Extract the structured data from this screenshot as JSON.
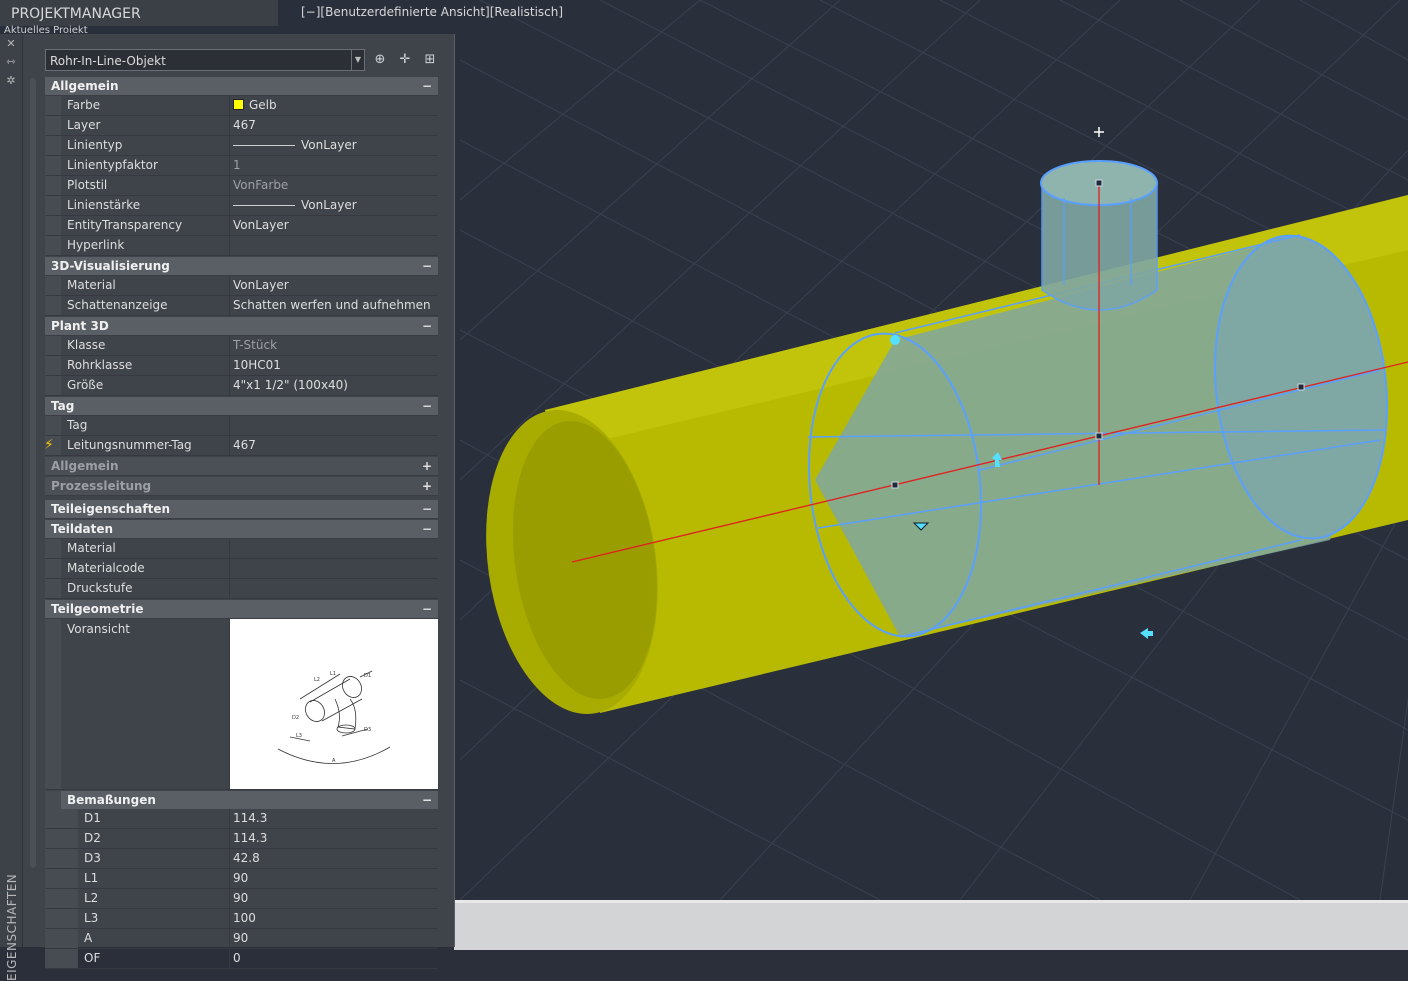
{
  "app": {
    "project_manager_title": "PROJEKTMANAGER",
    "project_manager_sub": "Aktuelles Projekt",
    "side_label": "EIGENSCHAFTEN",
    "view_label": "[−][Benutzerdefinierte Ansicht][Realistisch]"
  },
  "selector": {
    "value": "Rohr-In-Line-Objekt"
  },
  "toolbar": {
    "icons": [
      "quick-select-icon",
      "select-objects-icon",
      "toggle-pickadd-icon"
    ]
  },
  "sections": {
    "allgemein": {
      "title": "Allgemein",
      "rows": {
        "farbe": {
          "key": "Farbe",
          "value": "Gelb"
        },
        "layer": {
          "key": "Layer",
          "value": "467"
        },
        "linientyp": {
          "key": "Linientyp",
          "value": "VonLayer"
        },
        "linientypfaktor": {
          "key": "Linientypfaktor",
          "value": "1"
        },
        "plotstil": {
          "key": "Plotstil",
          "value": "VonFarbe"
        },
        "linienstaerke": {
          "key": "Linienstärke",
          "value": "VonLayer"
        },
        "transparency": {
          "key": "EntityTransparency",
          "value": "VonLayer"
        },
        "hyperlink": {
          "key": "Hyperlink",
          "value": ""
        }
      }
    },
    "visualisierung": {
      "title": "3D-Visualisierung",
      "rows": {
        "material": {
          "key": "Material",
          "value": "VonLayer"
        },
        "schatten": {
          "key": "Schattenanzeige",
          "value": "Schatten werfen und aufnehmen"
        }
      }
    },
    "plant3d": {
      "title": "Plant 3D",
      "rows": {
        "klasse": {
          "key": "Klasse",
          "value": "T-Stück"
        },
        "rohrklasse": {
          "key": "Rohrklasse",
          "value": "10HC01"
        },
        "groesse": {
          "key": "Größe",
          "value": "4\"x1 1/2\" (100x40)"
        }
      }
    },
    "tag": {
      "title": "Tag",
      "rows": {
        "tag": {
          "key": "Tag",
          "value": ""
        },
        "leitungsnummer": {
          "key": "Leitungsnummer-Tag",
          "value": "467"
        }
      }
    },
    "allgemein2": {
      "title": "Allgemein"
    },
    "prozessleitung": {
      "title": "Prozessleitung"
    },
    "teileigenschaften": {
      "title": "Teileigenschaften"
    },
    "teildaten": {
      "title": "Teildaten",
      "rows": {
        "material": {
          "key": "Material",
          "value": ""
        },
        "materialcode": {
          "key": "Materialcode",
          "value": ""
        },
        "druckstufe": {
          "key": "Druckstufe",
          "value": ""
        }
      }
    },
    "teilgeometrie": {
      "title": "Teilgeometrie",
      "voransicht": "Voransicht",
      "preview_labels": [
        "L2",
        "L1",
        "D1",
        "D2",
        "L3",
        "D3",
        "A"
      ]
    },
    "bemassungen": {
      "title": "Bemaßungen",
      "rows": {
        "d1": {
          "key": "D1",
          "value": "114.3"
        },
        "d2": {
          "key": "D2",
          "value": "114.3"
        },
        "d3": {
          "key": "D3",
          "value": "42.8"
        },
        "l1": {
          "key": "L1",
          "value": "90"
        },
        "l2": {
          "key": "L2",
          "value": "90"
        },
        "l3": {
          "key": "L3",
          "value": "100"
        },
        "a": {
          "key": "A",
          "value": "90"
        },
        "of": {
          "key": "OF",
          "value": "0"
        }
      }
    }
  },
  "toggles": {
    "collapse": "−",
    "expand": "+"
  },
  "colors": {
    "pipe_yellow": "#b5b800",
    "selection_blue": "#5aa0ff",
    "axis_red": "#e02020",
    "panel_bg": "#3f434a",
    "viewport_bg": "#2a2f3c"
  }
}
